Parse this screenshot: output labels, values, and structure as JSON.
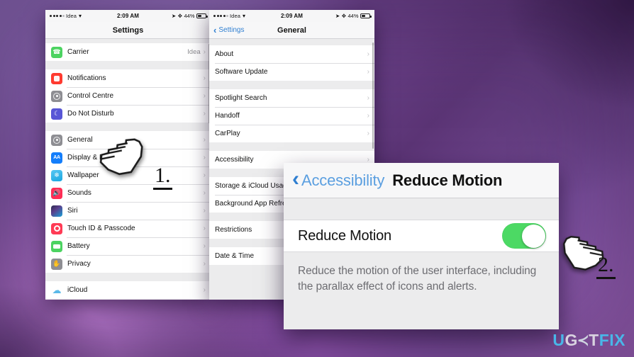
{
  "background": {
    "accent_purple": "#7a4f9c",
    "accent_light": "#c07fd6",
    "accent_dark": "#2a123a"
  },
  "phone_left": {
    "status": {
      "carrier": "Idea",
      "wifi_icon": "wifi-icon",
      "time": "2:09 AM",
      "location_icon": "location-arrow-icon",
      "bluetooth_icon": "bluetooth-icon",
      "battery_pct": "44%",
      "battery_icon": "battery-icon"
    },
    "nav": {
      "title": "Settings"
    },
    "groups": [
      {
        "rows": [
          {
            "icon": "phone-icon",
            "label": "Carrier",
            "value": "Idea",
            "chevron": "›"
          }
        ]
      },
      {
        "rows": [
          {
            "icon": "notifications-icon",
            "label": "Notifications",
            "value": "",
            "chevron": "›"
          },
          {
            "icon": "control-centre-icon",
            "label": "Control Centre",
            "value": "",
            "chevron": "›"
          },
          {
            "icon": "do-not-disturb-icon",
            "label": "Do Not Disturb",
            "value": "",
            "chevron": "›"
          }
        ]
      },
      {
        "rows": [
          {
            "icon": "general-icon",
            "label": "General",
            "value": "",
            "chevron": "›"
          },
          {
            "icon": "display-brightness-icon",
            "label": "Display & Brightness",
            "value": "",
            "chevron": "›"
          },
          {
            "icon": "wallpaper-icon",
            "label": "Wallpaper",
            "value": "",
            "chevron": "›"
          },
          {
            "icon": "sounds-icon",
            "label": "Sounds",
            "value": "",
            "chevron": "›"
          },
          {
            "icon": "siri-icon",
            "label": "Siri",
            "value": "",
            "chevron": "›"
          },
          {
            "icon": "touch-id-passcode-icon",
            "label": "Touch ID & Passcode",
            "value": "",
            "chevron": "›"
          },
          {
            "icon": "battery-icon",
            "label": "Battery",
            "value": "",
            "chevron": "›"
          },
          {
            "icon": "privacy-icon",
            "label": "Privacy",
            "value": "",
            "chevron": "›"
          }
        ]
      },
      {
        "rows": [
          {
            "icon": "icloud-icon",
            "label": "iCloud",
            "value": "",
            "chevron": "›"
          }
        ]
      }
    ]
  },
  "phone_right": {
    "status": {
      "carrier": "Idea",
      "time": "2:09 AM",
      "battery_pct": "44%"
    },
    "nav": {
      "back_label": "Settings",
      "back_chevron": "‹",
      "title": "General"
    },
    "groups": [
      {
        "rows": [
          {
            "label": "About",
            "chevron": "›"
          },
          {
            "label": "Software Update",
            "chevron": "›"
          }
        ]
      },
      {
        "rows": [
          {
            "label": "Spotlight Search",
            "chevron": "›"
          },
          {
            "label": "Handoff",
            "chevron": "›"
          },
          {
            "label": "CarPlay",
            "chevron": "›"
          }
        ]
      },
      {
        "rows": [
          {
            "label": "Accessibility",
            "chevron": "›"
          }
        ]
      },
      {
        "rows": [
          {
            "label": "Storage & iCloud Usage",
            "chevron": "›"
          },
          {
            "label": "Background App Refresh",
            "chevron": "›"
          }
        ]
      },
      {
        "rows": [
          {
            "label": "Restrictions",
            "chevron": "›"
          }
        ]
      },
      {
        "rows": [
          {
            "label": "Date & Time",
            "chevron": "›"
          }
        ]
      }
    ]
  },
  "reduce_motion_panel": {
    "back_chevron": "‹",
    "back_label": "Accessibility",
    "title": "Reduce Motion",
    "row_label": "Reduce Motion",
    "toggle_state": "on",
    "toggle_color": "#4cd964",
    "description": "Reduce the motion of the user interface, including the parallax effect of icons and alerts."
  },
  "annotations": {
    "step_one": "1.",
    "step_two": "2.",
    "cursor_one": "hand-pointer-cursor",
    "cursor_two": "hand-pointer-cursor"
  },
  "watermark": {
    "part_u": "U",
    "part_g": "G",
    "part_arrow": "≺",
    "part_t": "T",
    "part_fix": "FIX"
  }
}
